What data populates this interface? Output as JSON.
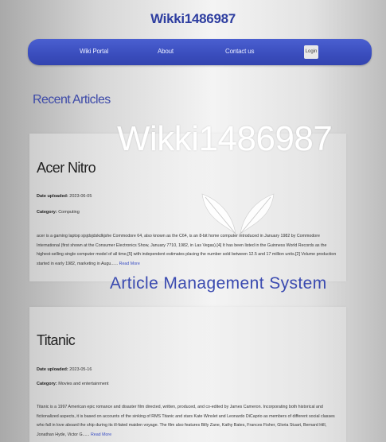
{
  "header": {
    "site_title": "Wikki1486987"
  },
  "nav": {
    "items": [
      {
        "label": "Wiki Portal"
      },
      {
        "label": "About"
      },
      {
        "label": "Contact us"
      }
    ],
    "login_label": "Login"
  },
  "main": {
    "section_heading": "Recent Articles",
    "articles": [
      {
        "title": "Acer Nitro",
        "date_label": "Date uploaded:",
        "date": "2023-06-05",
        "category_label": "Category:",
        "category": "Computing",
        "excerpt": "acer is a gaming laptop sjsjdsjdskdkjshe Commodore 64, also known as the C64, is an 8-bit home computer introduced in January 1982 by Commodore International (first shown at the Consumer Electronics Show, January 7?10, 1982, in Las Vegas).[4] It has been listed in the Guinness World Records as the highest-selling single computer model of all time,[5] with independent estimates placing the number sold between 12.5 and 17 million units.[2] Volume production started in early 1982, marketing in Augu......",
        "read_more": "Read More"
      },
      {
        "title": "Titanic",
        "date_label": "Date uploaded:",
        "date": "2023-05-16",
        "category_label": "Category:",
        "category": "Movies and entertainment",
        "excerpt": "Titanic is a 1997 American epic romance and disaster film directed, written, produced, and co-edited by James Cameron. Incorporating both historical and fictionalized aspects, it is based on accounts of the sinking of RMS Titanic and stars Kate Winslet and Leonardo DiCaprio as members of different social classes who fall in love aboard the ship during its ill-fated maiden voyage. The film also features Billy Zane, Kathy Bates, Frances Fisher, Gloria Stuart, Bernard Hill, Jonathan Hyde, Victor G......",
        "read_more": "Read More"
      }
    ]
  },
  "watermark": {
    "title": "Wikki1486987",
    "subtitle": "Article Management System",
    "logo_icon": "leaf-logo-icon"
  },
  "colors": {
    "nav_bg": "#3a4dbd",
    "title_blue": "#2e3ea0",
    "link_blue": "#3b4fc4",
    "watermark_text": "#ffffff"
  }
}
